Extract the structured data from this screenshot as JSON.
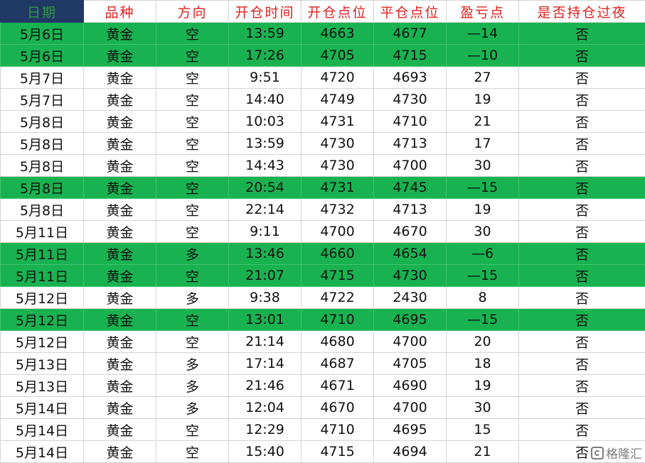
{
  "colors": {
    "header_text": "#e0201e",
    "header_date_bg": "#203864",
    "header_date_text": "#2e9b3a",
    "loss_row_bg": "#19b251"
  },
  "table": {
    "headers": [
      "日期",
      "品种",
      "方向",
      "开仓时间",
      "开仓点位",
      "平仓点位",
      "盈亏点",
      "是否持仓过夜"
    ],
    "rows": [
      {
        "loss": true,
        "cells": [
          "5月6日",
          "黄金",
          "空",
          "13:59",
          "4663",
          "4677",
          "—14",
          "否"
        ]
      },
      {
        "loss": true,
        "cells": [
          "5月6日",
          "黄金",
          "空",
          "17:26",
          "4705",
          "4715",
          "—10",
          "否"
        ]
      },
      {
        "loss": false,
        "cells": [
          "5月7日",
          "黄金",
          "空",
          "9:51",
          "4720",
          "4693",
          "27",
          "否"
        ]
      },
      {
        "loss": false,
        "cells": [
          "5月7日",
          "黄金",
          "空",
          "14:40",
          "4749",
          "4730",
          "19",
          "否"
        ]
      },
      {
        "loss": false,
        "cells": [
          "5月8日",
          "黄金",
          "空",
          "10:03",
          "4731",
          "4710",
          "21",
          "否"
        ]
      },
      {
        "loss": false,
        "cells": [
          "5月8日",
          "黄金",
          "空",
          "13:59",
          "4730",
          "4713",
          "17",
          "否"
        ]
      },
      {
        "loss": false,
        "cells": [
          "5月8日",
          "黄金",
          "空",
          "14:43",
          "4730",
          "4700",
          "30",
          "否"
        ]
      },
      {
        "loss": true,
        "cells": [
          "5月8日",
          "黄金",
          "空",
          "20:54",
          "4731",
          "4745",
          "—15",
          "否"
        ]
      },
      {
        "loss": false,
        "cells": [
          "5月8日",
          "黄金",
          "空",
          "22:14",
          "4732",
          "4713",
          "19",
          "否"
        ]
      },
      {
        "loss": false,
        "cells": [
          "5月11日",
          "黄金",
          "空",
          "9:11",
          "4700",
          "4670",
          "30",
          "否"
        ]
      },
      {
        "loss": true,
        "cells": [
          "5月11日",
          "黄金",
          "多",
          "13:46",
          "4660",
          "4654",
          "—6",
          "否"
        ]
      },
      {
        "loss": true,
        "cells": [
          "5月11日",
          "黄金",
          "空",
          "21:07",
          "4715",
          "4730",
          "—15",
          "否"
        ]
      },
      {
        "loss": false,
        "cells": [
          "5月12日",
          "黄金",
          "多",
          "9:38",
          "4722",
          "2430",
          "8",
          "否"
        ]
      },
      {
        "loss": true,
        "cells": [
          "5月12日",
          "黄金",
          "空",
          "13:01",
          "4710",
          "4695",
          "—15",
          "否"
        ]
      },
      {
        "loss": false,
        "cells": [
          "5月12日",
          "黄金",
          "空",
          "21:14",
          "4680",
          "4700",
          "20",
          "否"
        ]
      },
      {
        "loss": false,
        "cells": [
          "5月13日",
          "黄金",
          "多",
          "17:14",
          "4687",
          "4705",
          "18",
          "否"
        ]
      },
      {
        "loss": false,
        "cells": [
          "5月13日",
          "黄金",
          "多",
          "21:46",
          "4671",
          "4690",
          "19",
          "否"
        ]
      },
      {
        "loss": false,
        "cells": [
          "5月14日",
          "黄金",
          "多",
          "12:04",
          "4670",
          "4700",
          "30",
          "否"
        ]
      },
      {
        "loss": false,
        "cells": [
          "5月14日",
          "黄金",
          "空",
          "12:29",
          "4710",
          "4695",
          "15",
          "否"
        ]
      },
      {
        "loss": false,
        "cells": [
          "5月14日",
          "黄金",
          "空",
          "15:40",
          "4715",
          "4694",
          "21",
          "否"
        ]
      }
    ]
  },
  "watermark": {
    "text": "格隆汇",
    "icon": "gelonghui-logo-icon"
  }
}
